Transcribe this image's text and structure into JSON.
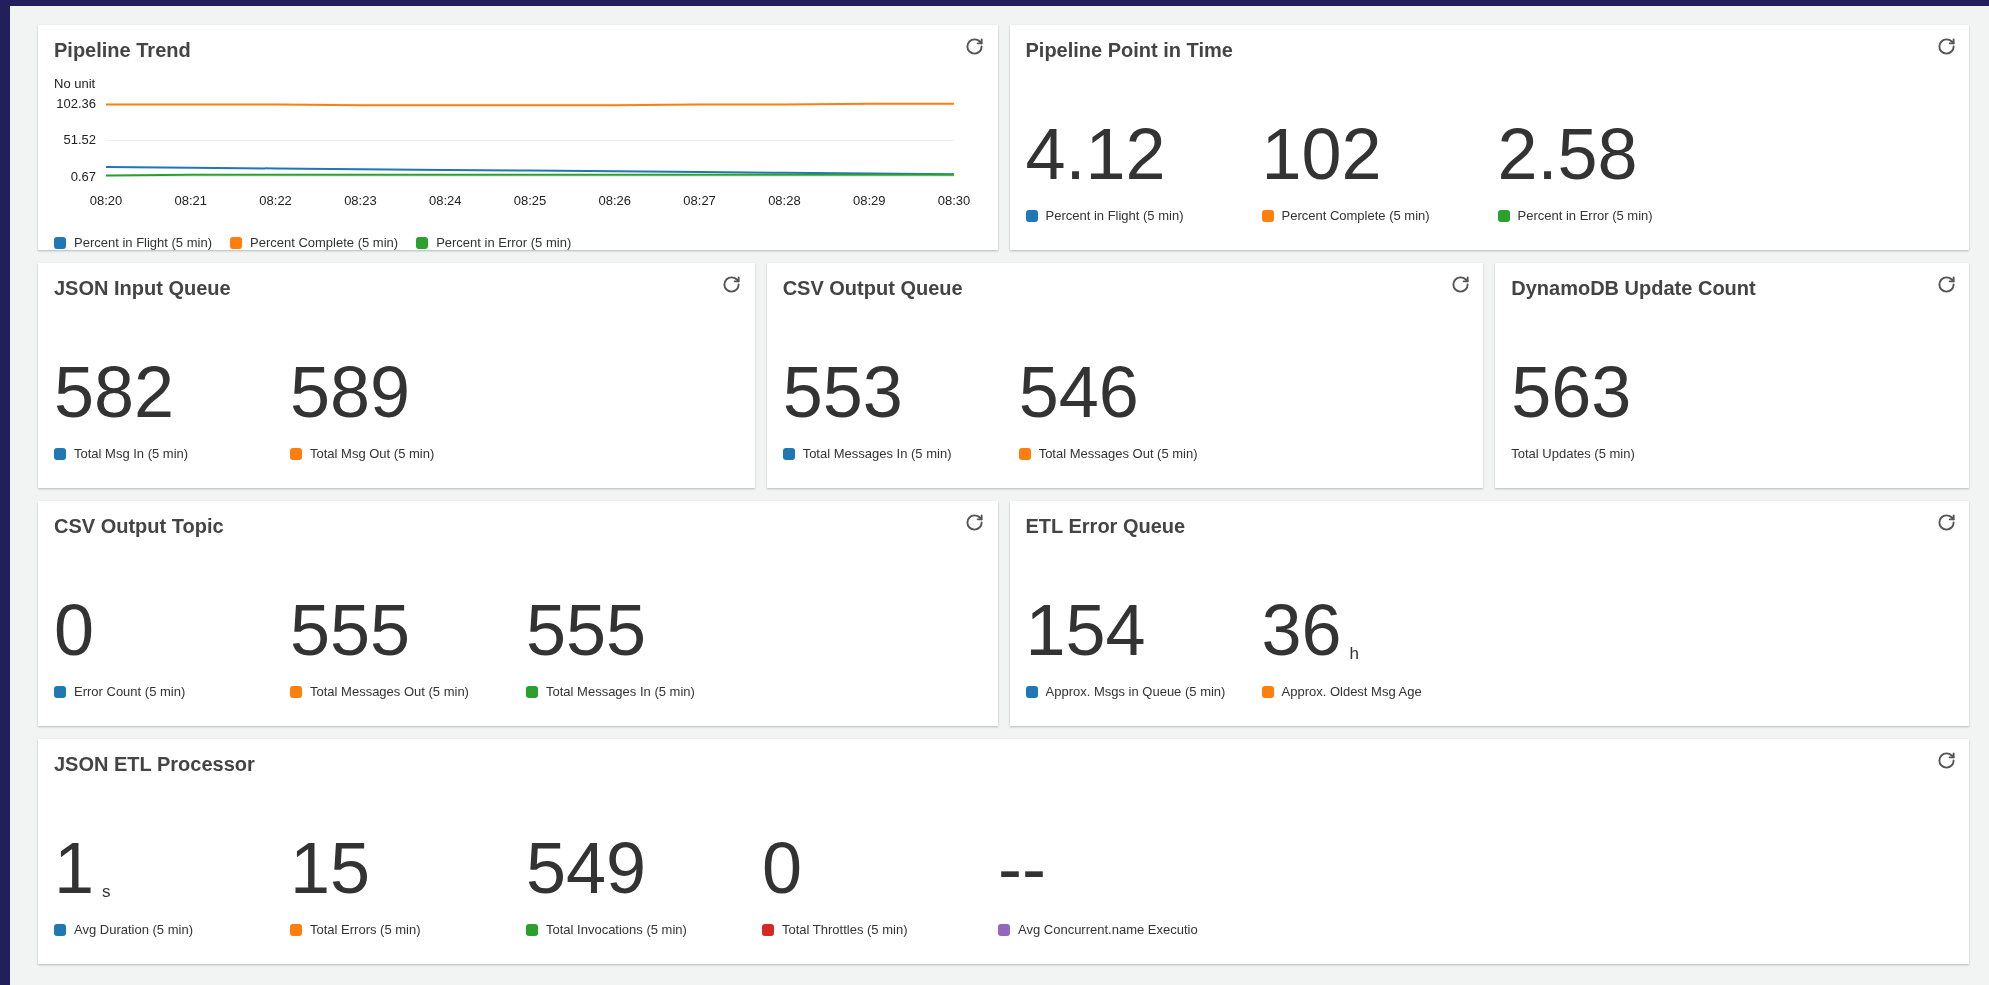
{
  "widgets": [
    {
      "kind": "chart",
      "title": "Pipeline Trend",
      "chart_data": {
        "type": "line",
        "ylabel": "No unit",
        "categories": [
          "08:20",
          "08:21",
          "08:22",
          "08:23",
          "08:24",
          "08:25",
          "08:26",
          "08:27",
          "08:28",
          "08:29",
          "08:30"
        ],
        "yticks": [
          0.67,
          51.52,
          102.36
        ],
        "ylim": [
          0,
          104
        ],
        "series": [
          {
            "name": "Percent in Flight (5 min)",
            "color": "#1f77b4",
            "values": [
              14,
              13,
              12,
              11,
              10,
              9,
              8,
              7,
              6,
              5,
              4
            ]
          },
          {
            "name": "Percent Complete (5 min)",
            "color": "#ff7f0e",
            "values": [
              102,
              102,
              102,
              101,
              101,
              101,
              101,
              102,
              102,
              103,
              103
            ]
          },
          {
            "name": "Percent in Error (5 min)",
            "color": "#2ca02c",
            "values": [
              2,
              3,
              3,
              3,
              3,
              3,
              3,
              3,
              3,
              3,
              3
            ]
          }
        ]
      }
    },
    {
      "kind": "metrics",
      "title": "Pipeline Point in Time",
      "metrics": [
        {
          "value": "4.12",
          "label": "Percent in Flight (5 min)",
          "color": "#1f77b4"
        },
        {
          "value": "102",
          "label": "Percent Complete (5 min)",
          "color": "#ff7f0e"
        },
        {
          "value": "2.58",
          "label": "Percent in Error (5 min)",
          "color": "#2ca02c"
        }
      ]
    },
    {
      "kind": "metrics",
      "title": "JSON Input Queue",
      "metrics": [
        {
          "value": "582",
          "label": "Total Msg In (5 min)",
          "color": "#1f77b4"
        },
        {
          "value": "589",
          "label": "Total Msg Out (5 min)",
          "color": "#ff7f0e"
        }
      ]
    },
    {
      "kind": "metrics",
      "title": "CSV Output Queue",
      "metrics": [
        {
          "value": "553",
          "label": "Total Messages In (5 min)",
          "color": "#1f77b4"
        },
        {
          "value": "546",
          "label": "Total Messages Out (5 min)",
          "color": "#ff7f0e"
        }
      ]
    },
    {
      "kind": "metrics",
      "title": "DynamoDB Update Count",
      "metrics": [
        {
          "value": "563",
          "label": "Total Updates (5 min)"
        }
      ]
    },
    {
      "kind": "metrics",
      "title": "CSV Output Topic",
      "metrics": [
        {
          "value": "0",
          "label": "Error Count (5 min)",
          "color": "#1f77b4"
        },
        {
          "value": "555",
          "label": "Total Messages Out (5 min)",
          "color": "#ff7f0e"
        },
        {
          "value": "555",
          "label": "Total Messages In (5 min)",
          "color": "#2ca02c"
        }
      ]
    },
    {
      "kind": "metrics",
      "title": "ETL Error Queue",
      "metrics": [
        {
          "value": "154",
          "label": "Approx. Msgs in Queue (5 min)",
          "color": "#1f77b4"
        },
        {
          "value": "36",
          "unit": "h",
          "label": "Approx. Oldest Msg Age",
          "color": "#ff7f0e"
        }
      ]
    },
    {
      "kind": "metrics",
      "title": "JSON ETL Processor",
      "metrics": [
        {
          "value": "1",
          "unit": "s",
          "label": "Avg Duration (5 min)",
          "color": "#1f77b4"
        },
        {
          "value": "15",
          "label": "Total Errors (5 min)",
          "color": "#ff7f0e"
        },
        {
          "value": "549",
          "label": "Total Invocations (5 min)",
          "color": "#2ca02c"
        },
        {
          "value": "0",
          "label": "Total Throttles (5 min)",
          "color": "#d62728"
        },
        {
          "value": "--",
          "label": "Avg Concurrent.name Executio",
          "color": "#9467bd"
        }
      ]
    }
  ]
}
